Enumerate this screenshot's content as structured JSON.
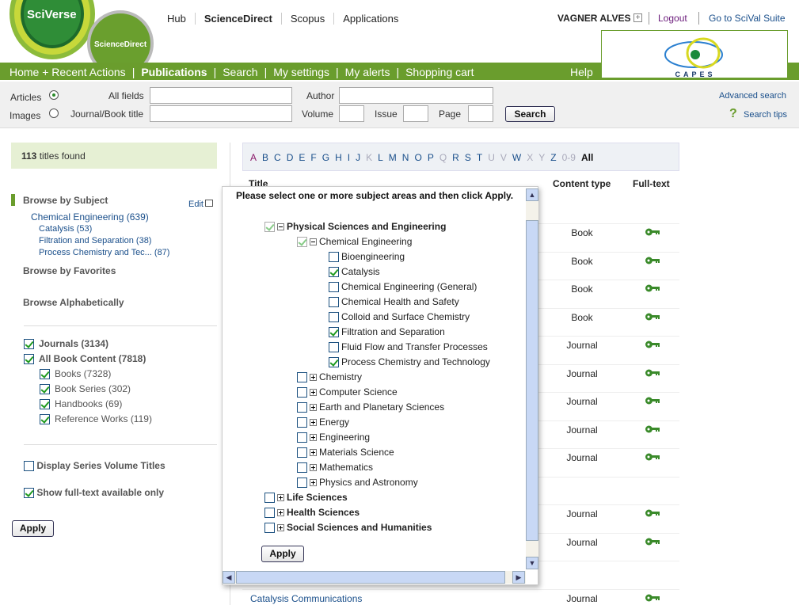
{
  "brand": {
    "sciverse": "SciVerse",
    "sciencedirect": "ScienceDirect"
  },
  "topnav": [
    "Hub",
    "ScienceDirect",
    "Scopus",
    "Applications"
  ],
  "user": {
    "name": "VAGNER ALVES",
    "logout": "Logout",
    "scival": "Go to SciVal Suite"
  },
  "capes_logo": "CAPES",
  "mainnav": [
    "Home + Recent Actions",
    "Publications",
    "Search",
    "My settings",
    "My alerts",
    "Shopping cart"
  ],
  "help": "Help",
  "search": {
    "articles": "Articles",
    "images": "Images",
    "all_fields": "All fields",
    "journal_title": "Journal/Book title",
    "author": "Author",
    "volume": "Volume",
    "issue": "Issue",
    "page": "Page",
    "button": "Search",
    "advanced": "Advanced search",
    "tips": "Search tips",
    "selected": "Articles"
  },
  "found": {
    "count": "113",
    "label": "titles found"
  },
  "browse": {
    "subject": "Browse by Subject",
    "edit": "Edit",
    "chem": "Chemical Engineering (639)",
    "subs": [
      "Catalysis (53)",
      "Filtration and Separation (38)",
      "Process Chemistry and Tec... (87)"
    ],
    "favorites": "Browse by Favorites",
    "alpha": "Browse Alphabetically"
  },
  "filters": [
    {
      "label": "Journals (3134)",
      "checked": true,
      "bold": true,
      "indent": 0
    },
    {
      "label": "All Book Content (7818)",
      "checked": true,
      "bold": true,
      "indent": 0
    },
    {
      "label": "Books (7328)",
      "checked": true,
      "indent": 1
    },
    {
      "label": "Book Series (302)",
      "checked": true,
      "indent": 1
    },
    {
      "label": "Handbooks (69)",
      "checked": true,
      "indent": 1
    },
    {
      "label": "Reference Works (119)",
      "checked": true,
      "indent": 1
    }
  ],
  "display_series": {
    "label": "Display Series Volume Titles",
    "checked": false
  },
  "fulltext_only": {
    "label": "Show full-text available only",
    "checked": true
  },
  "apply": "Apply",
  "alphabet": {
    "letters": [
      "A",
      "B",
      "C",
      "D",
      "E",
      "F",
      "G",
      "H",
      "I",
      "J",
      "K",
      "L",
      "M",
      "N",
      "O",
      "P",
      "Q",
      "R",
      "S",
      "T",
      "U",
      "V",
      "W",
      "X",
      "Y",
      "Z",
      "0-9",
      "All"
    ],
    "disabled": [
      "K",
      "Q",
      "U",
      "V",
      "X",
      "Y",
      "0-9"
    ],
    "visited": [
      "A"
    ],
    "current": "All"
  },
  "table": {
    "headers": [
      "Title",
      "Content type",
      "Full-text"
    ],
    "rows": [
      {
        "title": "",
        "type": "Book",
        "key": true
      },
      {
        "title": "",
        "type": "Book",
        "key": true
      },
      {
        "title": "",
        "type": "Book",
        "key": true
      },
      {
        "title": "",
        "type": "Book",
        "key": true
      },
      {
        "title": "",
        "type": "Journal",
        "key": true
      },
      {
        "title": "",
        "type": "Journal",
        "key": true
      },
      {
        "title": "",
        "type": "Journal",
        "key": true
      },
      {
        "title": "",
        "type": "Journal",
        "key": true
      },
      {
        "title": "",
        "type": "Journal",
        "key": true
      },
      {
        "title": "",
        "type": "",
        "key": false
      },
      {
        "title": "",
        "type": "Journal",
        "key": true
      },
      {
        "title": "",
        "type": "Journal",
        "key": true
      },
      {
        "title": "",
        "type": "",
        "key": false
      },
      {
        "title": "Catalysis Communications",
        "type": "Journal",
        "key": true
      }
    ]
  },
  "popup": {
    "instruction": "Please select one or more subject areas and then click Apply.",
    "apply": "Apply",
    "tree": [
      {
        "label": "Physical Sciences and Engineering",
        "level": 0,
        "checked": true,
        "disabled": true,
        "expanded": true,
        "bold": true
      },
      {
        "label": "Chemical Engineering",
        "level": 1,
        "checked": true,
        "disabled": true,
        "expanded": true
      },
      {
        "label": "Bioengineering",
        "level": 2,
        "checked": false
      },
      {
        "label": "Catalysis",
        "level": 2,
        "checked": true
      },
      {
        "label": "Chemical Engineering (General)",
        "level": 2,
        "checked": false
      },
      {
        "label": "Chemical Health and Safety",
        "level": 2,
        "checked": false
      },
      {
        "label": "Colloid and Surface Chemistry",
        "level": 2,
        "checked": false
      },
      {
        "label": "Filtration and Separation",
        "level": 2,
        "checked": true
      },
      {
        "label": "Fluid Flow and Transfer Processes",
        "level": 2,
        "checked": false
      },
      {
        "label": "Process Chemistry and Technology",
        "level": 2,
        "checked": true
      },
      {
        "label": "Chemistry",
        "level": 1,
        "checked": false,
        "expanded": false
      },
      {
        "label": "Computer Science",
        "level": 1,
        "checked": false,
        "expanded": false
      },
      {
        "label": "Earth and Planetary Sciences",
        "level": 1,
        "checked": false,
        "expanded": false
      },
      {
        "label": "Energy",
        "level": 1,
        "checked": false,
        "expanded": false
      },
      {
        "label": "Engineering",
        "level": 1,
        "checked": false,
        "expanded": false
      },
      {
        "label": "Materials Science",
        "level": 1,
        "checked": false,
        "expanded": false
      },
      {
        "label": "Mathematics",
        "level": 1,
        "checked": false,
        "expanded": false
      },
      {
        "label": "Physics and Astronomy",
        "level": 1,
        "checked": false,
        "expanded": false
      },
      {
        "label": "Life Sciences",
        "level": 0,
        "checked": false,
        "expanded": false,
        "bold": true
      },
      {
        "label": "Health Sciences",
        "level": 0,
        "checked": false,
        "expanded": false,
        "bold": true
      },
      {
        "label": "Social Sciences and Humanities",
        "level": 0,
        "checked": false,
        "expanded": false,
        "bold": true
      }
    ]
  },
  "colors": {
    "green": "#6a9d2d",
    "link": "#1a4f8b",
    "key": "#3a8a2a"
  }
}
